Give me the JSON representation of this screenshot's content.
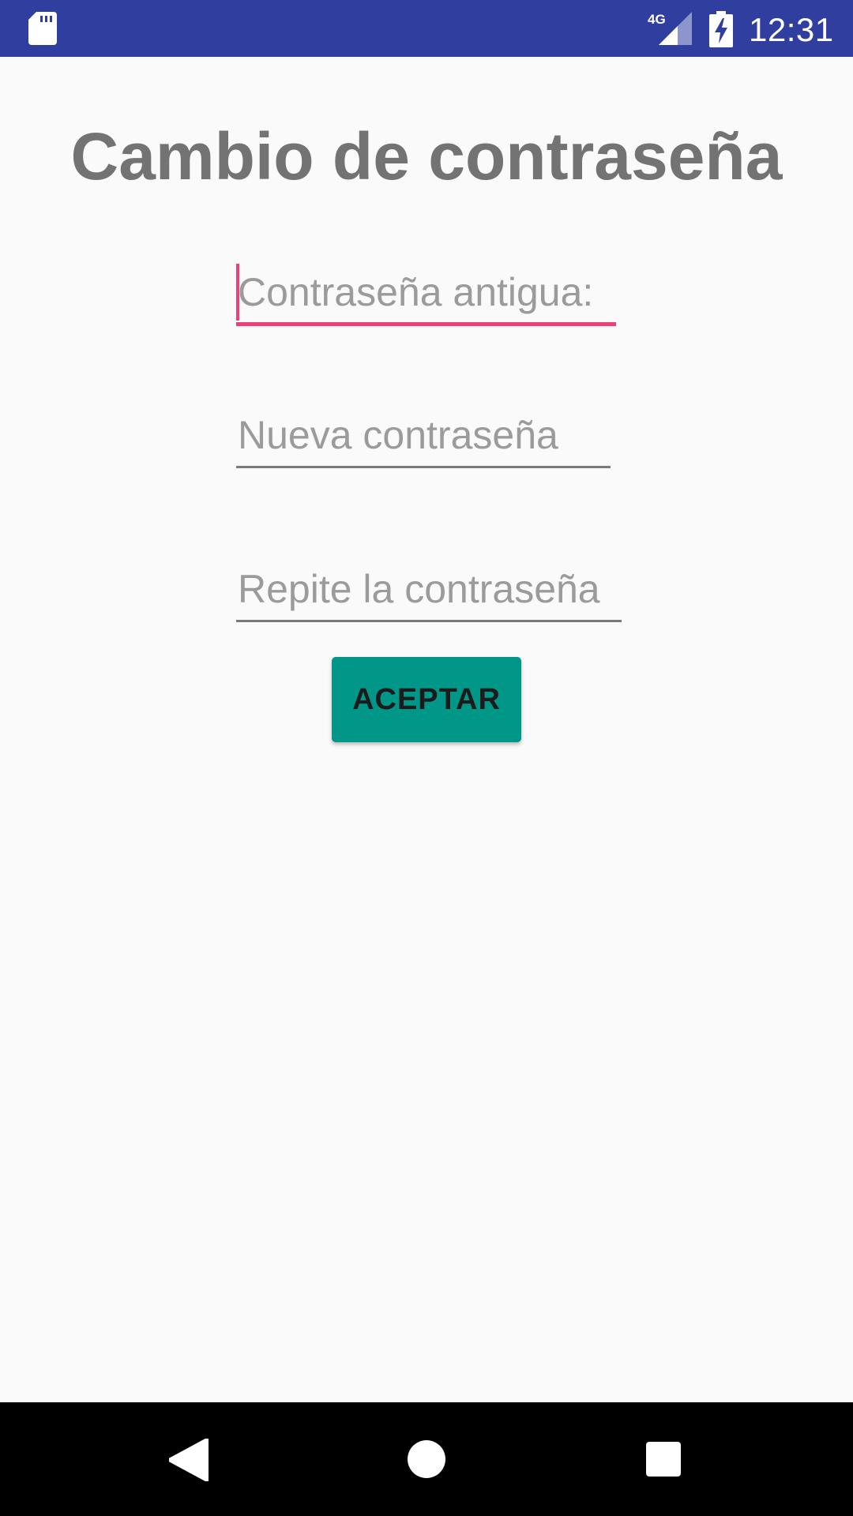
{
  "status_bar": {
    "time": "12:31",
    "network": "4G",
    "color": "#303f9f",
    "icons": [
      "sd-card-icon",
      "signal-4g-icon",
      "battery-charging-icon"
    ]
  },
  "title": "Cambio de contraseña",
  "form": {
    "old_password_placeholder": "Contraseña antigua:",
    "new_password_placeholder": "Nueva contraseña",
    "repeat_password_placeholder": "Repite la contraseña",
    "accept_label": "ACEPTAR"
  },
  "colors": {
    "accent": "#ec407a",
    "button": "#009688",
    "title": "#737373",
    "background": "#fafafa"
  },
  "nav_bar": {
    "icons": [
      "back-icon",
      "home-icon",
      "recents-icon"
    ]
  }
}
